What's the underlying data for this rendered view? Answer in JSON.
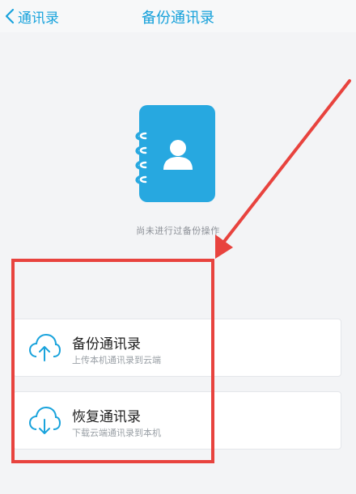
{
  "nav": {
    "back_label": "通讯录",
    "title": "备份通讯录",
    "back_icon": "chevron-left-icon"
  },
  "main": {
    "illustration_icon": "contact-book-icon",
    "status_text": "尚未进行过备份操作"
  },
  "actions": [
    {
      "title": "备份通讯录",
      "subtitle": "上传本机通讯录到云端",
      "icon": "cloud-upload-icon"
    },
    {
      "title": "恢复通讯录",
      "subtitle": "下载云端通讯录到本机",
      "icon": "cloud-download-icon"
    }
  ],
  "colors": {
    "accent": "#19a3dc",
    "book": "#27a8e0",
    "highlight": "#e8433e"
  }
}
